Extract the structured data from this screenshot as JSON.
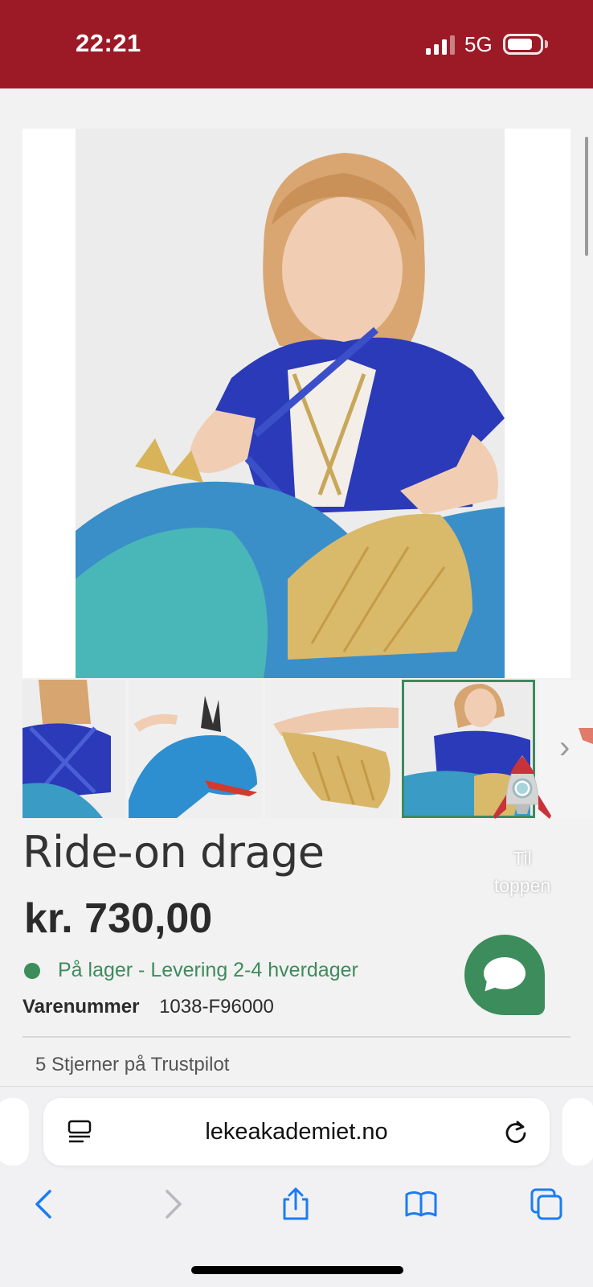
{
  "status_bar": {
    "time": "22:21",
    "network": "5G",
    "battery_level": 0.78
  },
  "product": {
    "title": "Ride-on drage",
    "price": "kr. 730,00",
    "stock_status": "På lager - Levering 2-4 hverdager",
    "sku_label": "Varenummer",
    "sku_value": "1038-F96000",
    "cut_text": "5 Stjerner på Trustpilot"
  },
  "gallery": {
    "thumbnail_count": 4,
    "active_index": 3,
    "next_icon": "chevron-right-icon"
  },
  "to_top": {
    "line1": "Til",
    "line2": "toppen"
  },
  "chat": {
    "icon": "chat-bubble-icon",
    "color": "#3d8c5c"
  },
  "browser": {
    "url": "lekeakademiet.no",
    "toolbar": [
      "back-icon",
      "forward-icon",
      "share-icon",
      "bookmarks-icon",
      "tabs-icon"
    ]
  },
  "colors": {
    "brand": "#9b1a26",
    "accent_green": "#3d8c5c",
    "ios_blue": "#1a7cf5"
  }
}
